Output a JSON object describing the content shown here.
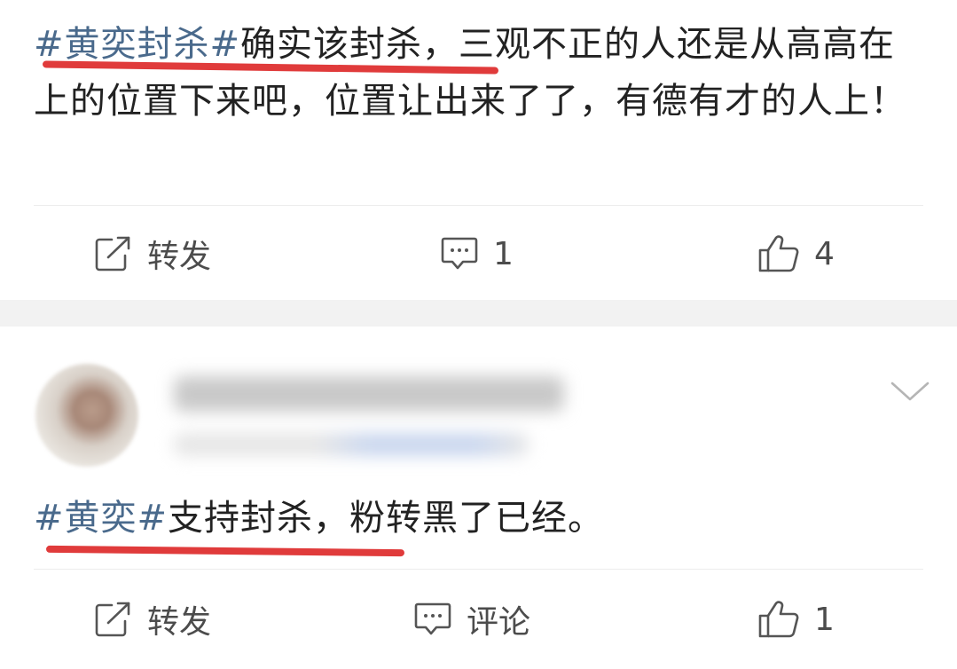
{
  "posts": [
    {
      "hashtag": "#黄奕封杀#",
      "body": "确实该封杀，三观不正的人还是从高高在上的位置下来吧，位置让出来了了，有德有才的人上！",
      "actions": {
        "repost": "转发",
        "comment": "1",
        "like": "4"
      }
    },
    {
      "hashtag": "#黄奕#",
      "body": "支持封杀，粉转黑了已经。",
      "actions": {
        "repost": "转发",
        "comment": "评论",
        "like": "1"
      }
    }
  ],
  "icons": {
    "repost": "repost-icon",
    "comment": "comment-icon",
    "like": "thumbs-up-icon",
    "menu": "chevron-down-icon"
  },
  "colors": {
    "hashtag": "#4a6a8c",
    "underline": "#e03b3b",
    "gap": "#f2f2f2"
  }
}
